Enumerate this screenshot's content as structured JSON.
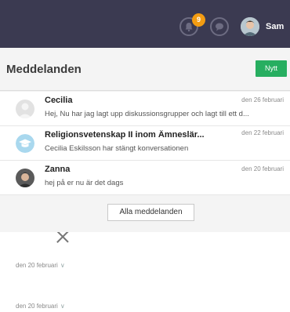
{
  "topbar": {
    "notification_count": "9",
    "user_name": "Sam",
    "icons": [
      "bell-icon",
      "chat-icon",
      "user-avatar"
    ]
  },
  "panel": {
    "title": "Meddelanden",
    "new_button": "Nytt",
    "messages": [
      {
        "from": "Cecilia",
        "date": "den 26 februari",
        "snippet": "Hej, Nu har jag lagt upp diskussionsgrupper och lagt till ett d..."
      },
      {
        "from": "Religionsvetenskap II inom Ämneslär...",
        "date": "den 22 februari",
        "snippet": "Cecilia Eskilsson har stängt konversationen"
      },
      {
        "from": "Zanna",
        "date": "den 20 februari",
        "snippet": "hej på er nu är det dags"
      }
    ],
    "all_messages_button": "Alla meddelanden"
  },
  "background": {
    "dates": [
      "den 20 februari",
      "den 20 februari"
    ]
  }
}
